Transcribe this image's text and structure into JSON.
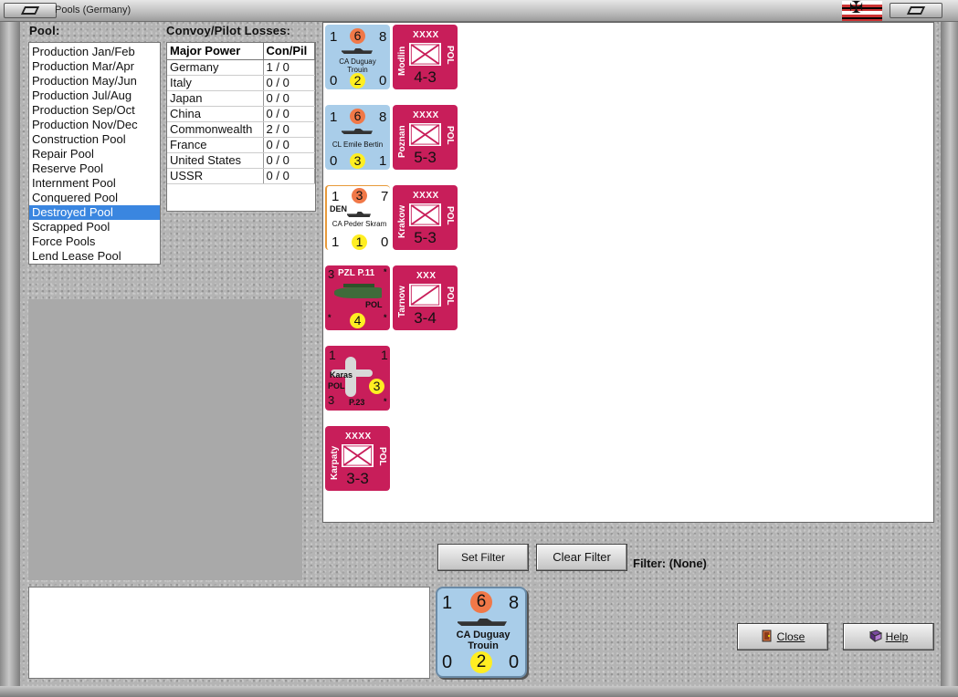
{
  "window": {
    "title": "Pools (Germany)"
  },
  "pool_section": {
    "label": "Pool:",
    "items": [
      "Production Jan/Feb",
      "Production Mar/Apr",
      "Production May/Jun",
      "Production Jul/Aug",
      "Production Sep/Oct",
      "Production Nov/Dec",
      "Construction Pool",
      "Repair Pool",
      "Reserve Pool",
      "Internment Pool",
      "Conquered Pool",
      "Destroyed Pool",
      "Scrapped Pool",
      "Force Pools",
      "Lend Lease Pool"
    ],
    "selected": "Destroyed Pool"
  },
  "losses": {
    "label": "Convoy/Pilot Losses:",
    "headers": [
      "Major Power",
      "Con/Pil"
    ],
    "rows": [
      [
        "Germany",
        "1 / 0"
      ],
      [
        "Italy",
        "0 / 0"
      ],
      [
        "Japan",
        "0 / 0"
      ],
      [
        "China",
        "0 / 0"
      ],
      [
        "Commonwealth",
        "2 / 0"
      ],
      [
        "France",
        "0 / 0"
      ],
      [
        "United States",
        "0 / 0"
      ],
      [
        "USSR",
        "0 / 0"
      ]
    ]
  },
  "counters": {
    "duguay": {
      "tl": "1",
      "tc": "6",
      "tr": "8",
      "name_l1": "CA Duguay",
      "name_l2": "Trouin",
      "bl": "0",
      "bc": "2",
      "br": "0"
    },
    "bertin": {
      "tl": "1",
      "tc": "6",
      "tr": "8",
      "name_l1": "CL Emile Bertin",
      "bl": "0",
      "bc": "3",
      "br": "1"
    },
    "skram": {
      "tl": "1",
      "tc": "3",
      "tr": "7",
      "nat": "DEN",
      "name_l1": "CA Peder Skram",
      "bl": "1",
      "bc": "1",
      "br": "0"
    },
    "pzl": {
      "tl": "3",
      "title": "PZL P.11",
      "star": "*",
      "nat": "POL",
      "bc": "4"
    },
    "karas": {
      "tl": "1",
      "tr": "1",
      "name": "Karas",
      "nat": "POL",
      "bc": "3",
      "bl": "3",
      "model": "P.23",
      "star": "*"
    },
    "karpaty": {
      "echelon": "XXXX",
      "name": "Karpaty",
      "nat": "POL",
      "strength": "3-3"
    },
    "modlin": {
      "echelon": "XXXX",
      "name": "Modlin",
      "nat": "POL",
      "strength": "4-3"
    },
    "poznan": {
      "echelon": "XXXX",
      "name": "Poznan",
      "nat": "POL",
      "strength": "5-3"
    },
    "krakow": {
      "echelon": "XXXX",
      "name": "Krakow",
      "nat": "POL",
      "strength": "5-3"
    },
    "tarnow": {
      "echelon": "XXX",
      "name": "Tarnow",
      "nat": "POL",
      "strength": "3-4"
    }
  },
  "filter": {
    "set_label": "Set Filter",
    "clear_label": "Clear Filter",
    "status_label": "Filter:  (None)"
  },
  "selected_counter": {
    "tl": "1",
    "tc": "6",
    "tr": "8",
    "name_l1": "CA Duguay",
    "name_l2": "Trouin",
    "bl": "0",
    "bc": "2",
    "br": "0"
  },
  "footer": {
    "close_label": "Close",
    "help_label": "Help"
  },
  "colors": {
    "naval": "#a9cde9",
    "poland": "#c81e5a",
    "selection": "#3a86e0"
  }
}
